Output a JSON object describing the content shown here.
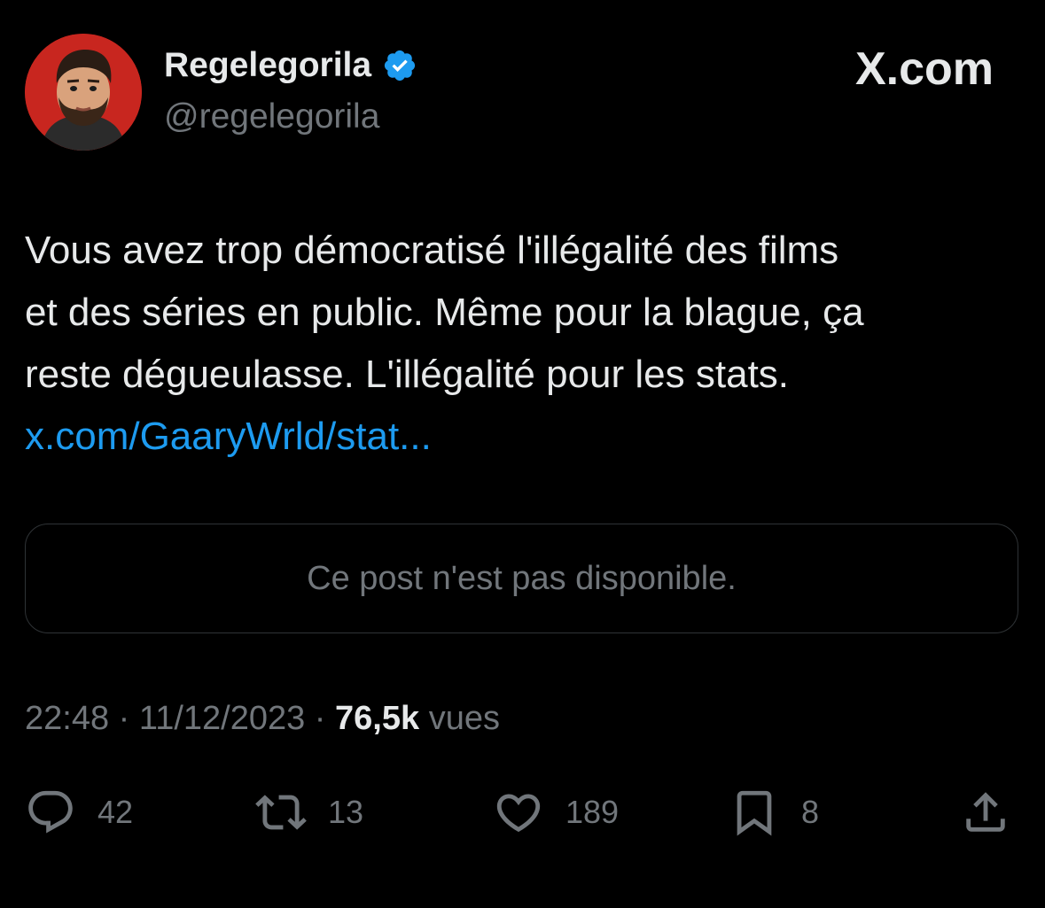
{
  "brand": "X.com",
  "author": {
    "display_name": "Regelegorila",
    "handle": "@regelegorila",
    "verified": true
  },
  "tweet": {
    "lines": [
      "Vous avez trop démocratisé l'illégalité des films",
      "et des séries en public. Même pour la blague, ça",
      "reste dégueulasse. L'illégalité pour les stats."
    ],
    "link": "x.com/GaaryWrld/stat..."
  },
  "quote": {
    "unavailable_text": "Ce post n'est pas disponible."
  },
  "meta": {
    "time": "22:48",
    "separator": " · ",
    "date": "11/12/2023",
    "views_count": "76,5k",
    "views_label": "vues"
  },
  "actions": {
    "replies": "42",
    "reposts": "13",
    "likes": "189",
    "bookmarks": "8"
  },
  "icons": {
    "reply": "reply-icon",
    "repost": "repost-icon",
    "like": "heart-icon",
    "bookmark": "bookmark-icon",
    "share": "share-icon",
    "verified": "verified-badge-icon",
    "logo": "x-logo-icon"
  },
  "colors": {
    "background": "#000000",
    "text": "#e7e9ea",
    "secondary": "#71767b",
    "link": "#1d9bf0",
    "border": "#2f3336"
  }
}
